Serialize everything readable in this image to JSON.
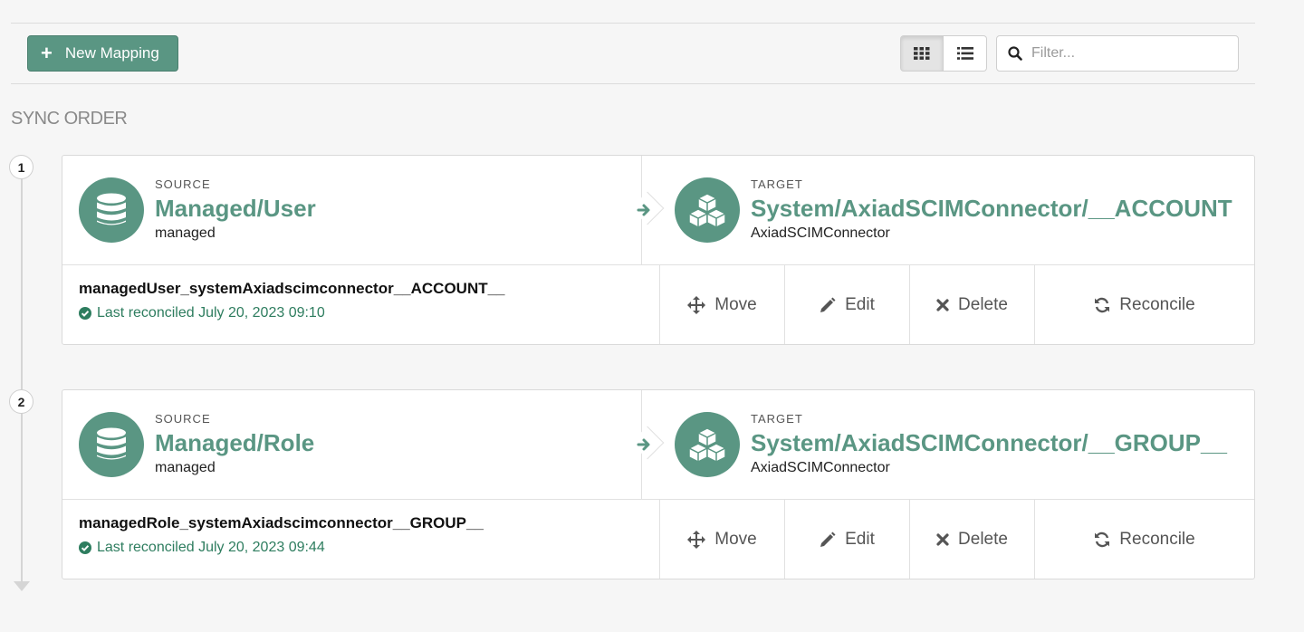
{
  "toolbar": {
    "new_mapping_label": "New Mapping",
    "filter_placeholder": "Filter...",
    "grid_view_icon": "grid-icon",
    "list_view_icon": "list-icon"
  },
  "section_title": "SYNC ORDER",
  "colors": {
    "accent": "#5a9683",
    "status_green": "#2e7d5f"
  },
  "mappings": [
    {
      "order": "1",
      "source_label": "SOURCE",
      "source_name": "Managed/User",
      "source_sub": "managed",
      "target_label": "TARGET",
      "target_name": "System/AxiadSCIMConnector/__ACCOUNT",
      "target_sub": "AxiadSCIMConnector",
      "mapping_name": "managedUser_systemAxiadscimconnector__ACCOUNT__",
      "status": "Last reconciled July 20, 2023 09:10",
      "actions": {
        "move": "Move",
        "edit": "Edit",
        "delete": "Delete",
        "reconcile": "Reconcile"
      }
    },
    {
      "order": "2",
      "source_label": "SOURCE",
      "source_name": "Managed/Role",
      "source_sub": "managed",
      "target_label": "TARGET",
      "target_name": "System/AxiadSCIMConnector/__GROUP__",
      "target_sub": "AxiadSCIMConnector",
      "mapping_name": "managedRole_systemAxiadscimconnector__GROUP__",
      "status": "Last reconciled July 20, 2023 09:44",
      "actions": {
        "move": "Move",
        "edit": "Edit",
        "delete": "Delete",
        "reconcile": "Reconcile"
      }
    }
  ]
}
